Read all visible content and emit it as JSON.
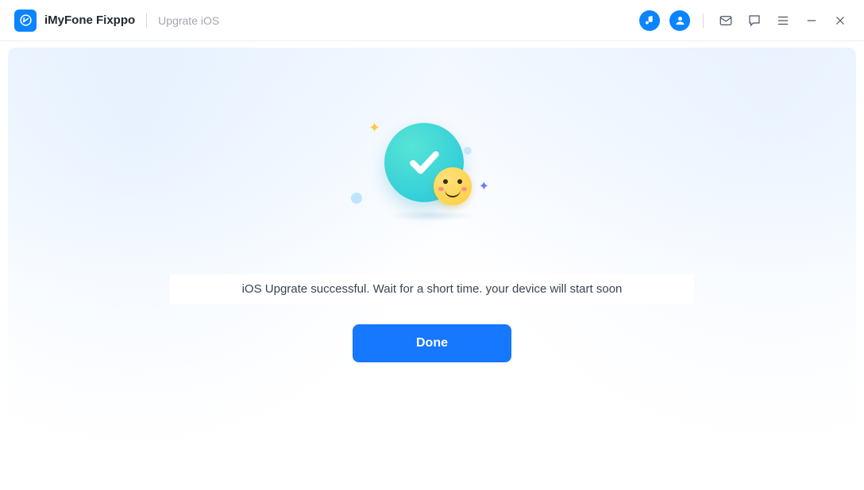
{
  "header": {
    "app_name": "iMyFone Fixppo",
    "breadcrumb": "Upgrate iOS",
    "icons": {
      "music": "music-note-icon",
      "account": "account-icon"
    }
  },
  "main": {
    "status_message": "iOS Upgrate successful. Wait for a short time. your device will start soon",
    "done_label": "Done"
  }
}
